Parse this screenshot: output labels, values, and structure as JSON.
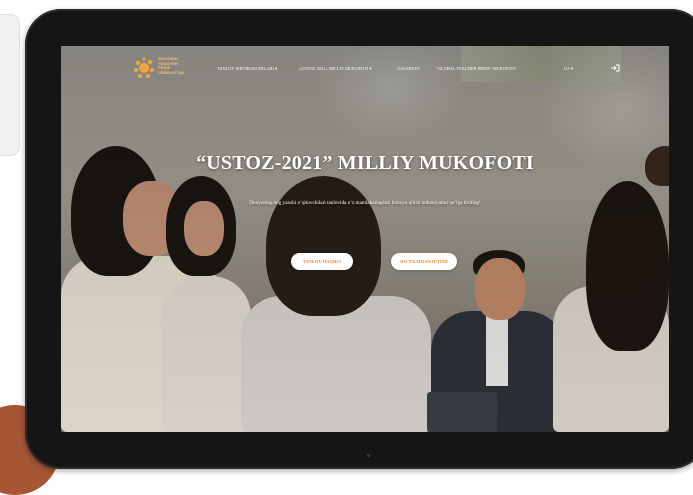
{
  "site": {
    "logo_lines": [
      "NATIONAL",
      "TEACHER",
      "PRIZE",
      "UZBEKISTAN"
    ]
  },
  "nav": {
    "items": [
      "TANLOV ISHTIROKCHILARI ▾",
      "«USTOZ-2021» MILLIY MUKOFOTI ▾",
      "GALEREYA",
      "\"GLOBAL TEACHER PRIZE\" MUKOFOTI",
      "UZ ▾"
    ],
    "login_icon": "sign-in-icon"
  },
  "hero": {
    "title": "“USTOZ-2021” MILLIY MUKOFOTI",
    "subtitle": "Dunyoning eng yaxshi o‘qituvchilari tanlovida o‘z mamlakatingizni himoya qilish imkoniyatini qo‘lga kiriting!",
    "buttons": [
      "TANLOV HAQIDA",
      "RO‘YXATDAN O‘TISH"
    ]
  },
  "colors": {
    "accent": "#e6892a",
    "logo": "#f3c56e",
    "tablet_frame": "#151515"
  }
}
